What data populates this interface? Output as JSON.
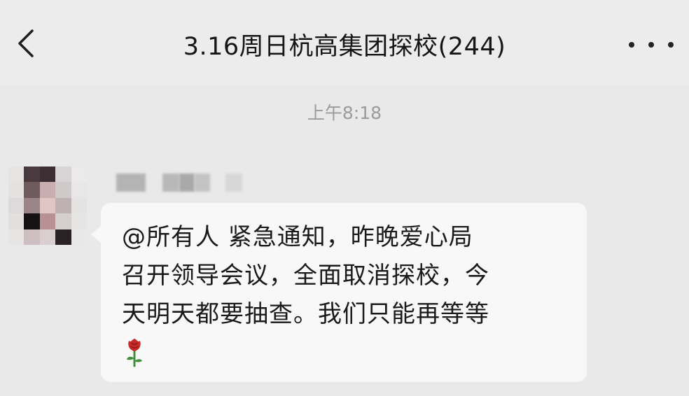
{
  "header": {
    "title": "3.16周日杭高集团探校(244)",
    "back_icon": "chevron-left-icon",
    "more_icon": "more-horizontal-icon"
  },
  "chat": {
    "timestamp": "上午8:18",
    "messages": [
      {
        "sender_redacted": true,
        "avatar_pixelated": true,
        "lines": [
          "@所有人  紧急通知，昨晚爱心局",
          "召开领导会议，全面取消探校，今",
          "天明天都要抽查。我们只能再等等"
        ],
        "trailing_emoji": "rose-icon"
      }
    ]
  },
  "colors": {
    "background": "#e9e9e9",
    "bubble": "#f8f8f8",
    "timestamp_text": "#9b9b9b",
    "rose_red": "#c62a2a",
    "rose_green": "#3f8f3a"
  }
}
